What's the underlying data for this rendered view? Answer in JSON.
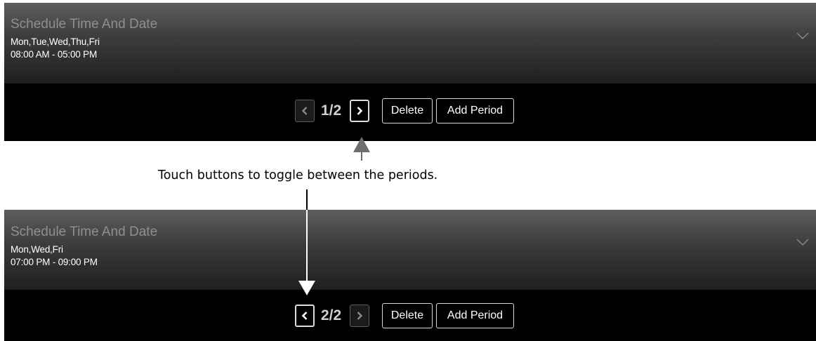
{
  "panels": [
    {
      "header": {
        "title": "Schedule Time And Date",
        "days": "Mon,Tue,Wed,Thu,Fri",
        "time_range": "08:00 AM - 05:00 PM"
      },
      "toolbar": {
        "page_indicator": "1/2",
        "delete_label": "Delete",
        "add_period_label": "Add Period"
      }
    },
    {
      "header": {
        "title": "Schedule Time And Date",
        "days": "Mon,Wed,Fri",
        "time_range": "07:00 PM - 09:00 PM"
      },
      "toolbar": {
        "page_indicator": "2/2",
        "delete_label": "Delete",
        "add_period_label": "Add Period"
      }
    }
  ],
  "annotation": {
    "caption": "Touch buttons to toggle between the periods."
  },
  "icons": {
    "expand": "chevron-down-icon",
    "previous": "chevron-left-icon",
    "next": "chevron-right-icon"
  },
  "colors": {
    "header_top": "#5e5e5e",
    "header_bottom": "#1f1f1f",
    "toolbar_background": "#000000",
    "title_text": "#8f8f8f",
    "body_text": "#ffffff"
  }
}
